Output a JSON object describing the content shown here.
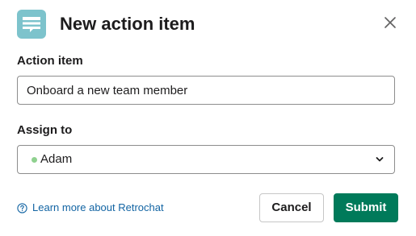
{
  "header": {
    "title": "New action item",
    "app_icon": "speech-bubble-icon",
    "close_icon": "close-icon"
  },
  "action_item": {
    "label": "Action item",
    "value": "Onboard a new team member"
  },
  "assign_to": {
    "label": "Assign to",
    "selected": "Adam",
    "presence": "active"
  },
  "footer": {
    "help_link": "Learn more about Retrochat",
    "help_icon": "question-circle-icon",
    "cancel_label": "Cancel",
    "submit_label": "Submit"
  },
  "colors": {
    "app_icon_bg": "#7dc3cc",
    "presence_active": "#8fd18f",
    "link": "#1264a3",
    "submit_bg": "#007a5a"
  }
}
